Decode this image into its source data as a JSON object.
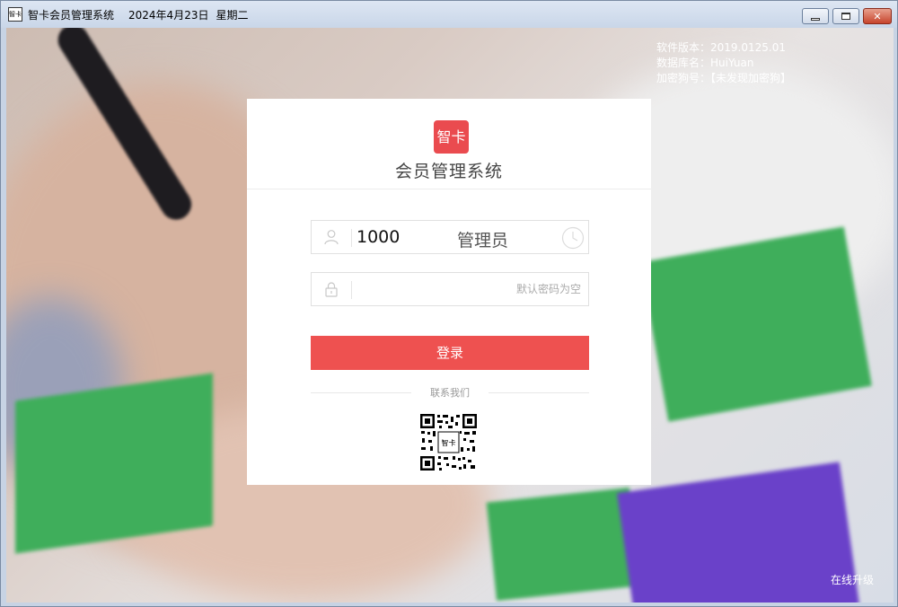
{
  "titlebar": {
    "icon_text": "智卡",
    "title": "智卡会员管理系统",
    "date": "2024年4月23日",
    "weekday": "星期二"
  },
  "info": {
    "version": "软件版本：2019.0125.01",
    "database": "数据库名：HuiYuan",
    "dongle": "加密狗号：【未发现加密狗】"
  },
  "login": {
    "logo_text": "智卡",
    "title": "会员管理系统",
    "user_id": "1000",
    "user_role": "管理员",
    "password_placeholder": "默认密码为空",
    "login_label": "登录",
    "contact_label": "联系我们",
    "qr_label": "智卡"
  },
  "footer": {
    "upgrade": "在线升级"
  },
  "colors": {
    "accent": "#ee5150",
    "logo": "#ea4b4f"
  }
}
